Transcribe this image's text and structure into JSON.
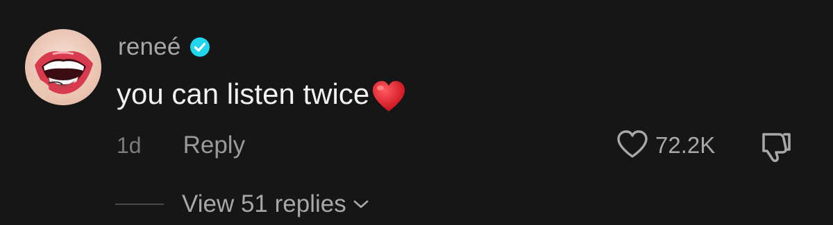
{
  "comment": {
    "avatar_icon": "lips-avatar-icon",
    "username": "reneé",
    "verified_icon": "verified-badge-icon",
    "text": "you can listen twice",
    "emoji_icon": "red-heart-emoji-icon",
    "timestamp": "1d",
    "reply_label": "Reply",
    "like_icon": "heart-outline-icon",
    "like_count": "72.2K",
    "dislike_icon": "thumbs-down-icon",
    "view_replies_label": "View 51 replies",
    "chevron_icon": "chevron-down-icon"
  },
  "colors": {
    "background": "#161616",
    "username": "#a8a8a8",
    "comment_text": "#f2f2f2",
    "verified": "#20d5ec",
    "emoji_heart": "#e8202a",
    "muted": "#7c7c7c"
  }
}
